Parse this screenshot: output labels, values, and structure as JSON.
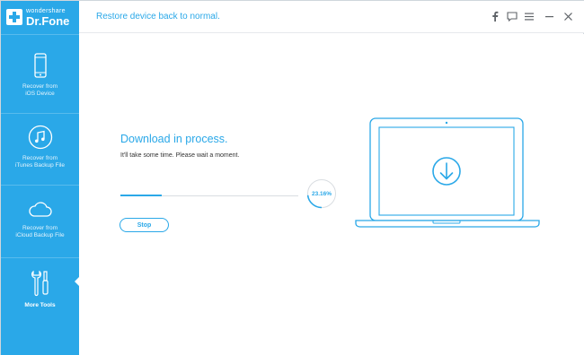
{
  "app": {
    "brand": "wondershare",
    "product": "Dr.Fone",
    "logo_icon": "plus-cross-logo-icon",
    "accent_color": "#2aa8e8"
  },
  "titlebar": {
    "title": "Restore device back to normal.",
    "buttons": [
      {
        "name": "facebook-icon",
        "glyph": "f"
      },
      {
        "name": "feedback-icon",
        "glyph": "chat"
      },
      {
        "name": "menu-icon",
        "glyph": "≡"
      },
      {
        "name": "minimize-icon",
        "glyph": "−"
      },
      {
        "name": "close-icon",
        "glyph": "✕"
      }
    ]
  },
  "sidebar": {
    "items": [
      {
        "icon": "iphone-icon",
        "label_line1": "Recover from",
        "label_line2": "iOS Device",
        "active": false
      },
      {
        "icon": "itunes-music-icon",
        "label_line1": "Recover from",
        "label_line2": "iTunes Backup File",
        "active": false
      },
      {
        "icon": "icloud-icon",
        "label_line1": "Recover from",
        "label_line2": "iCloud Backup File",
        "active": false
      },
      {
        "icon": "tools-icon",
        "label_line1": "More Tools",
        "label_line2": "",
        "active": true
      }
    ]
  },
  "main": {
    "heading": "Download in process.",
    "subtext": "It'll take some time. Please wait a moment.",
    "progress_percent": 23.16,
    "progress_label": "23.16%",
    "stop_label": "Stop",
    "illustration_icon": "laptop-download-icon"
  }
}
